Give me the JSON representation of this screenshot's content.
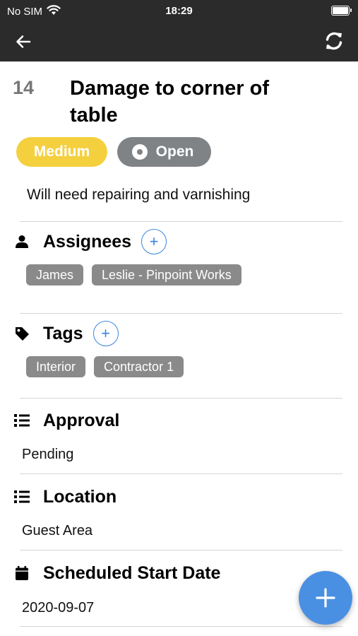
{
  "status_bar": {
    "carrier": "No SIM",
    "time": "18:29",
    "icons": [
      "wifi-icon",
      "battery-icon"
    ]
  },
  "nav": {
    "icons": [
      "arrow-left-icon",
      "sync-icon"
    ]
  },
  "issue": {
    "number": "14",
    "title": "Damage to corner of table",
    "priority": "Medium",
    "status": "Open",
    "description": "Will need repairing and varnishing"
  },
  "sections": {
    "assignees": {
      "title": "Assignees",
      "add_label": "+",
      "items": [
        "James",
        "Leslie - Pinpoint Works"
      ]
    },
    "tags": {
      "title": "Tags",
      "add_label": "+",
      "items": [
        "Interior",
        "Contractor 1"
      ]
    },
    "approval": {
      "title": "Approval",
      "value": "Pending"
    },
    "location": {
      "title": "Location",
      "value": "Guest Area"
    },
    "scheduled_start": {
      "title": "Scheduled Start Date",
      "value": "2020-09-07"
    }
  },
  "colors": {
    "header_bg": "#2b2b2b",
    "priority_medium": "#f4d03f",
    "status_open": "#808386",
    "chip_bg": "#8a8a8a",
    "accent": "#4a90e2"
  }
}
